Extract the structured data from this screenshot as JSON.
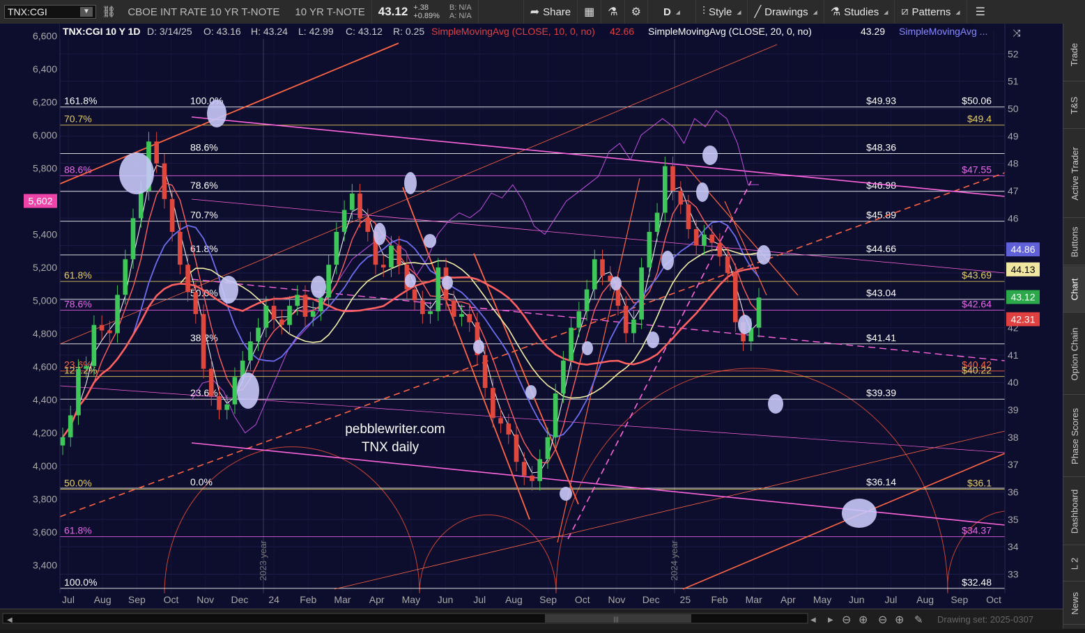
{
  "toolbar": {
    "symbol": "TNX:CGI",
    "description": "CBOE INT RATE 10 YR T-NOTE",
    "short_description": "10 YR T-NOTE",
    "last_price": "43.12",
    "change": "+.38",
    "change_pct": "+0.89%",
    "bid": "B: N/A",
    "ask": "A: N/A",
    "share_label": "Share",
    "timeframe": "D",
    "style_label": "Style",
    "drawings_label": "Drawings",
    "studies_label": "Studies",
    "patterns_label": "Patterns"
  },
  "legend": {
    "symbol_tf": "TNX:CGI 10 Y 1D",
    "date": "D: 3/14/25",
    "open": "O: 43.16",
    "high": "H: 43.24",
    "low": "L: 42.99",
    "close": "C: 43.12",
    "range": "R: 0.25",
    "sma10_label": "SimpleMovingAvg (CLOSE, 10, 0, no)",
    "sma10_value": "42.66",
    "sma20_label": "SimpleMovingAvg (CLOSE, 20, 0, no)",
    "sma20_value": "43.29",
    "sma_more": "SimpleMovingAvg ..."
  },
  "watermark": {
    "line1": "pebblewriter.com",
    "line2": "TNX daily"
  },
  "sidebar_tabs": [
    "Trade",
    "T&S",
    "Active Trader",
    "Buttons",
    "Chart",
    "Option Chain",
    "Phase Scores",
    "Dashboard",
    "L 2",
    "News"
  ],
  "drawing_set": "Drawing set: 2025-0307",
  "colors": {
    "background": "#0d0d2e",
    "fib_yellow": "#e8d060",
    "fib_magenta": "#ee66ee",
    "fib_white": "#ffffff",
    "channel_red": "#ff6644",
    "channel_pink": "#ff66dd",
    "sma_red": "#ff6060",
    "sma_blue": "#6e6ef0",
    "sma_yellow": "#f5f0a8",
    "spx_overlay": "#c050e0"
  },
  "chart_data": {
    "type": "line",
    "title": "TNX:CGI 10 Y 1D",
    "x_ticks": [
      "Jul",
      "Aug",
      "Sep",
      "Oct",
      "Nov",
      "Dec",
      "24",
      "Feb",
      "Mar",
      "Apr",
      "May",
      "Jun",
      "Jul",
      "Aug",
      "Sep",
      "Oct",
      "Nov",
      "Dec",
      "25",
      "Feb",
      "Mar",
      "Apr",
      "May",
      "Jun",
      "Jul",
      "Aug",
      "Sep",
      "Oct"
    ],
    "year_labels": [
      "2023 year",
      "2024 year"
    ],
    "right_axis": {
      "ticks": [
        33,
        34,
        35,
        36,
        37,
        38,
        39,
        40,
        41,
        42,
        43,
        44,
        45,
        46,
        47,
        48,
        49,
        50,
        51,
        52
      ],
      "range": [
        32.3,
        52.9
      ]
    },
    "left_axis": {
      "ticks": [
        "3,400",
        "3,600",
        "3,800",
        "4,000",
        "4,200",
        "4,400",
        "4,600",
        "4,800",
        "5,000",
        "5,200",
        "5,400",
        "5,600",
        "5,800",
        "6,000",
        "6,200",
        "6,400",
        "6,600"
      ],
      "range": [
        3230,
        6640
      ]
    },
    "left_marker": {
      "label": "5,602",
      "value": 5602
    },
    "right_markers": [
      {
        "label": "44.86",
        "value": 44.86,
        "color": "#6060d8"
      },
      {
        "label": "44.13",
        "value": 44.13,
        "color": "#f0e8a0"
      },
      {
        "label": "43.12",
        "value": 43.12,
        "color": "#2aa84a"
      },
      {
        "label": "42.31",
        "value": 42.31,
        "color": "#e04040"
      }
    ],
    "fib_levels": [
      {
        "value": 50.06,
        "left": "161.8%",
        "mid": "100.0%",
        "label": "$49.93",
        "right": "$50.06",
        "color": "#ffffff"
      },
      {
        "value": 49.4,
        "left": "70.7%",
        "mid": "",
        "label": "",
        "right": "$49.4",
        "color": "#e8d060"
      },
      {
        "value": 48.36,
        "left": "",
        "mid": "88.6%",
        "label": "$48.36",
        "right": "",
        "color": "#ffffff"
      },
      {
        "value": 47.55,
        "left": "88.6%",
        "mid": "",
        "label": "",
        "right": "$47.55",
        "color": "#ee66ee"
      },
      {
        "value": 46.98,
        "left": "",
        "mid": "78.6%",
        "label": "$46.98",
        "right": "",
        "color": "#ffffff"
      },
      {
        "value": 45.89,
        "left": "",
        "mid": "70.7%",
        "label": "$45.89",
        "right": "",
        "color": "#ffffff"
      },
      {
        "value": 44.66,
        "left": "",
        "mid": "61.8%",
        "label": "$44.66",
        "right": "",
        "color": "#ffffff"
      },
      {
        "value": 43.69,
        "left": "61.8%",
        "mid": "",
        "label": "",
        "right": "$43.69",
        "color": "#e8d060"
      },
      {
        "value": 43.04,
        "left": "",
        "mid": "50.0%",
        "label": "$43.04",
        "right": "",
        "color": "#ffffff"
      },
      {
        "value": 42.64,
        "left": "78.6%",
        "mid": "",
        "label": "",
        "right": "$42.64",
        "color": "#ee66ee"
      },
      {
        "value": 41.41,
        "left": "",
        "mid": "38.2%",
        "label": "$41.41",
        "right": "",
        "color": "#ffffff"
      },
      {
        "value": 40.42,
        "left": "23.6%",
        "mid": "",
        "label": "",
        "right": "$40.42",
        "color": "#ff6644"
      },
      {
        "value": 40.22,
        "left": "127.2%",
        "mid": "",
        "label": "",
        "right": "$40.22",
        "color": "#e8d060"
      },
      {
        "value": 39.39,
        "left": "",
        "mid": "23.6%",
        "label": "$39.39",
        "right": "",
        "color": "#ffffff"
      },
      {
        "value": 36.1,
        "left": "50.0%",
        "mid": "",
        "label": "",
        "right": "$36.1",
        "color": "#e8d060"
      },
      {
        "value": 36.14,
        "left": "",
        "mid": "0.0%",
        "label": "$36.14",
        "right": "",
        "color": "#ffffff"
      },
      {
        "value": 34.37,
        "left": "61.8%",
        "mid": "",
        "label": "",
        "right": "$34.37",
        "color": "#ee66ee"
      },
      {
        "value": 32.48,
        "left": "100.0%",
        "mid": "",
        "label": "",
        "right": "$32.48",
        "color": "#ffffff"
      }
    ],
    "price_series": [
      {
        "x": 0,
        "y": 38.0
      },
      {
        "x": 1,
        "y": 38.8
      },
      {
        "x": 2,
        "y": 40.5
      },
      {
        "x": 3,
        "y": 40.6
      },
      {
        "x": 4,
        "y": 42.1
      },
      {
        "x": 5,
        "y": 41.9
      },
      {
        "x": 6,
        "y": 41.8
      },
      {
        "x": 7,
        "y": 43.2
      },
      {
        "x": 8,
        "y": 44.5
      },
      {
        "x": 9,
        "y": 46.0
      },
      {
        "x": 10,
        "y": 47.0
      },
      {
        "x": 11,
        "y": 48.8
      },
      {
        "x": 12,
        "y": 48.0
      },
      {
        "x": 13,
        "y": 46.7
      },
      {
        "x": 14,
        "y": 45.5
      },
      {
        "x": 15,
        "y": 44.3
      },
      {
        "x": 16,
        "y": 43.3
      },
      {
        "x": 17,
        "y": 42.5
      },
      {
        "x": 18,
        "y": 40.5
      },
      {
        "x": 19,
        "y": 39.5
      },
      {
        "x": 20,
        "y": 39.0
      },
      {
        "x": 21,
        "y": 39.2
      },
      {
        "x": 22,
        "y": 40.2
      },
      {
        "x": 23,
        "y": 40.8
      },
      {
        "x": 24,
        "y": 41.5
      },
      {
        "x": 25,
        "y": 42.0
      },
      {
        "x": 26,
        "y": 42.8
      },
      {
        "x": 27,
        "y": 42.3
      },
      {
        "x": 28,
        "y": 42.1
      },
      {
        "x": 29,
        "y": 42.8
      },
      {
        "x": 30,
        "y": 43.2
      },
      {
        "x": 31,
        "y": 42.4
      },
      {
        "x": 32,
        "y": 42.6
      },
      {
        "x": 33,
        "y": 43.1
      },
      {
        "x": 34,
        "y": 44.3
      },
      {
        "x": 35,
        "y": 45.5
      },
      {
        "x": 36,
        "y": 46.3
      },
      {
        "x": 37,
        "y": 46.9
      },
      {
        "x": 38,
        "y": 46.0
      },
      {
        "x": 39,
        "y": 45.5
      },
      {
        "x": 40,
        "y": 44.3
      },
      {
        "x": 41,
        "y": 44.2
      },
      {
        "x": 42,
        "y": 45.0
      },
      {
        "x": 43,
        "y": 44.3
      },
      {
        "x": 44,
        "y": 43.4
      },
      {
        "x": 45,
        "y": 43.0
      },
      {
        "x": 46,
        "y": 42.5
      },
      {
        "x": 47,
        "y": 42.6
      },
      {
        "x": 48,
        "y": 44.2
      },
      {
        "x": 49,
        "y": 43.0
      },
      {
        "x": 50,
        "y": 42.4
      },
      {
        "x": 51,
        "y": 42.5
      },
      {
        "x": 52,
        "y": 42.2
      },
      {
        "x": 53,
        "y": 41.0
      },
      {
        "x": 54,
        "y": 39.8
      },
      {
        "x": 55,
        "y": 38.7
      },
      {
        "x": 56,
        "y": 38.5
      },
      {
        "x": 57,
        "y": 38.1
      },
      {
        "x": 58,
        "y": 37.1
      },
      {
        "x": 59,
        "y": 36.6
      },
      {
        "x": 60,
        "y": 36.4
      },
      {
        "x": 61,
        "y": 37.2
      },
      {
        "x": 62,
        "y": 38.0
      },
      {
        "x": 63,
        "y": 39.6
      },
      {
        "x": 64,
        "y": 40.8
      },
      {
        "x": 65,
        "y": 42.0
      },
      {
        "x": 66,
        "y": 42.6
      },
      {
        "x": 67,
        "y": 43.4
      },
      {
        "x": 68,
        "y": 44.5
      },
      {
        "x": 69,
        "y": 43.9
      },
      {
        "x": 70,
        "y": 43.7
      },
      {
        "x": 71,
        "y": 42.8
      },
      {
        "x": 72,
        "y": 41.8
      },
      {
        "x": 73,
        "y": 42.3
      },
      {
        "x": 74,
        "y": 44.2
      },
      {
        "x": 75,
        "y": 45.5
      },
      {
        "x": 76,
        "y": 46.2
      },
      {
        "x": 77,
        "y": 47.9
      },
      {
        "x": 78,
        "y": 47.0
      },
      {
        "x": 79,
        "y": 46.5
      },
      {
        "x": 80,
        "y": 45.6
      },
      {
        "x": 81,
        "y": 45.0
      },
      {
        "x": 82,
        "y": 45.4
      },
      {
        "x": 83,
        "y": 45.1
      },
      {
        "x": 84,
        "y": 44.6
      },
      {
        "x": 85,
        "y": 44.0
      },
      {
        "x": 86,
        "y": 42.2
      },
      {
        "x": 87,
        "y": 41.5
      },
      {
        "x": 88,
        "y": 42.0
      },
      {
        "x": 89,
        "y": 43.1
      }
    ]
  }
}
